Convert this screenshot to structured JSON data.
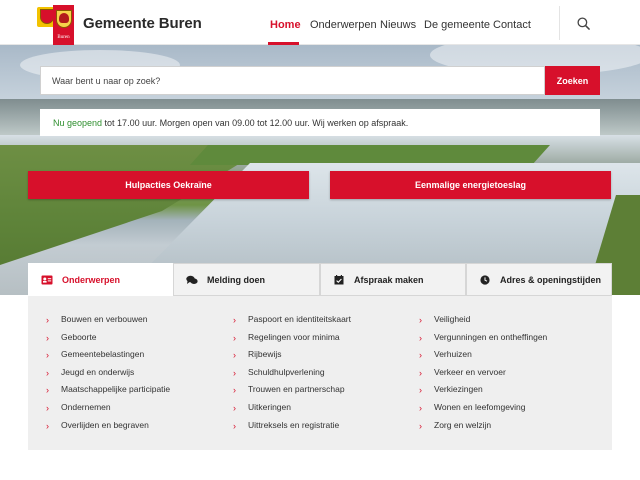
{
  "header": {
    "brand": "Gemeente Buren",
    "logo_text": "Buren",
    "nav": [
      {
        "label": "Home",
        "active": true
      },
      {
        "label": "Onderwerpen",
        "active": false
      },
      {
        "label": "Nieuws",
        "active": false
      },
      {
        "label": "De gemeente",
        "active": false
      },
      {
        "label": "Contact",
        "active": false
      }
    ],
    "search_icon": "search-icon"
  },
  "search": {
    "placeholder": "Waar bent u naar op zoek?",
    "button_label": "Zoeken"
  },
  "opening": {
    "status": "Nu geopend",
    "text": " tot 17.00 uur. Morgen open van 09.00 tot 12.00 uur. Wij werken op afspraak."
  },
  "quick_buttons": [
    {
      "label": "Hulpacties Oekraïne"
    },
    {
      "label": "Eenmalige energietoeslag"
    }
  ],
  "tabs": [
    {
      "label": "Onderwerpen",
      "icon": "id-card-icon",
      "active": true
    },
    {
      "label": "Melding doen",
      "icon": "chat-bubbles-icon",
      "active": false
    },
    {
      "label": "Afspraak maken",
      "icon": "calendar-check-icon",
      "active": false
    },
    {
      "label": "Adres & openingstijden",
      "icon": "clock-icon",
      "active": false
    }
  ],
  "topics": {
    "column1": [
      "Bouwen en verbouwen",
      "Geboorte",
      "Gemeentebelastingen",
      "Jeugd en onderwijs",
      "Maatschappelijke participatie",
      "Ondernemen",
      "Overlijden en begraven"
    ],
    "column2": [
      "Paspoort en identiteitskaart",
      "Regelingen voor minima",
      "Rijbewijs",
      "Schuldhulpverlening",
      "Trouwen en partnerschap",
      "Uitkeringen",
      "Uittreksels en registratie"
    ],
    "column3": [
      "Veiligheid",
      "Vergunningen en ontheffingen",
      "Verhuizen",
      "Verkeer en vervoer",
      "Verkiezingen",
      "Wonen en leefomgeving",
      "Zorg en welzijn"
    ]
  },
  "colors": {
    "accent": "#d7102b",
    "open_status": "#2f8f2f",
    "panel_bg": "#efefef"
  }
}
